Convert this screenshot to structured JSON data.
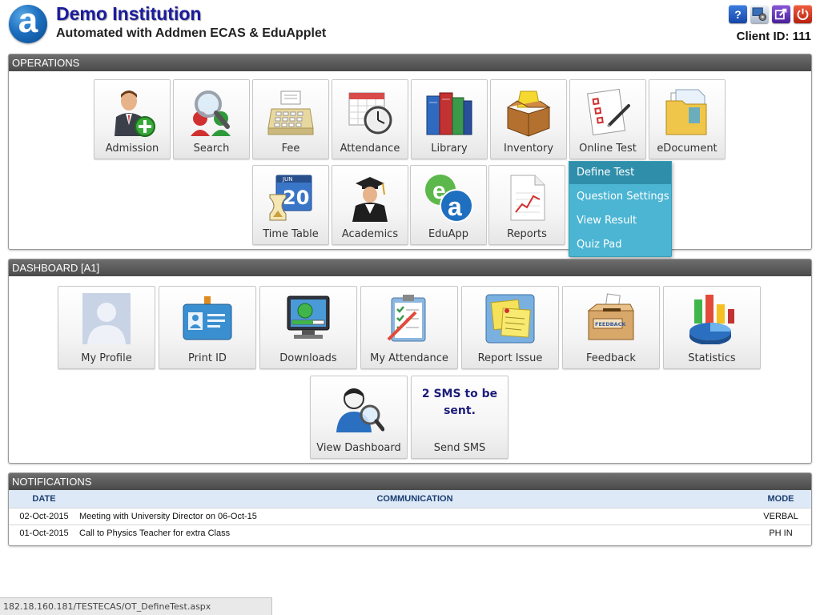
{
  "header": {
    "logo_letter": "a",
    "institution_name": "Demo Institution",
    "subtitle": "Automated with Addmen ECAS & EduApplet",
    "client_id": "Client ID: 111",
    "icons": [
      "help-icon",
      "settings-icon",
      "edit-icon",
      "power-icon"
    ],
    "help_glyph": "?"
  },
  "operations": {
    "title": "OPERATIONS",
    "tiles": [
      {
        "label": "Admission"
      },
      {
        "label": "Search"
      },
      {
        "label": "Fee"
      },
      {
        "label": "Attendance"
      },
      {
        "label": "Library"
      },
      {
        "label": "Inventory"
      },
      {
        "label": "Online Test"
      },
      {
        "label": "eDocument"
      },
      {
        "label": "Time Table"
      },
      {
        "label": "Academics"
      },
      {
        "label": "EduApp"
      },
      {
        "label": "Reports"
      }
    ],
    "calendar_text": "20",
    "calendar_month": "JUN",
    "eduapp_letters": [
      "e",
      "a"
    ],
    "online_test_menu": {
      "items": [
        "Define Test",
        "Question Settings",
        "View Result",
        "Quiz Pad"
      ],
      "active_index": 0
    }
  },
  "dashboard": {
    "title": "DASHBOARD [A1]",
    "tiles": [
      {
        "label": "My Profile"
      },
      {
        "label": "Print ID"
      },
      {
        "label": "Downloads"
      },
      {
        "label": "My Attendance"
      },
      {
        "label": "Report Issue"
      },
      {
        "label": "Feedback"
      },
      {
        "label": "Statistics"
      },
      {
        "label": "View Dashboard"
      },
      {
        "label": "Send SMS"
      }
    ],
    "sms_message": "2 SMS to be sent.",
    "feedback_box_text": "FEEDBACK"
  },
  "notifications": {
    "title": "NOTIFICATIONS",
    "columns": [
      "DATE",
      "COMMUNICATION",
      "MODE"
    ],
    "rows": [
      {
        "date": "02-Oct-2015",
        "communication": "Meeting with University Director on 06-Oct-15",
        "mode": "VERBAL"
      },
      {
        "date": "01-Oct-2015",
        "communication": "Call to Physics Teacher for extra Class",
        "mode": "PH IN"
      }
    ]
  },
  "status_bar": {
    "url": "182.18.160.181/TESTECAS/OT_DefineTest.aspx"
  },
  "colors": {
    "header_title": "#1b1b9e",
    "panel_header": "#555555",
    "dropdown_bg": "#4bb5d3",
    "dropdown_active": "#2f8fab",
    "table_header_bg": "#dde9f7"
  }
}
